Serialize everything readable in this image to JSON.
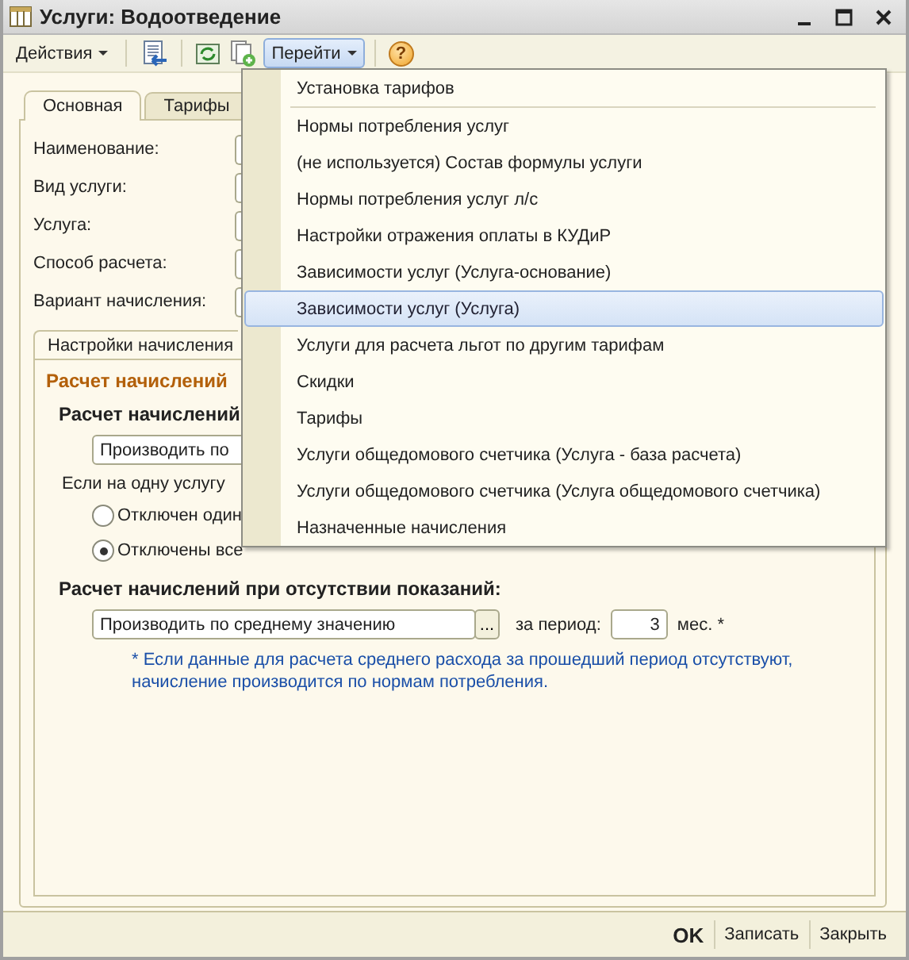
{
  "window": {
    "title": "Услуги: Водоотведение"
  },
  "toolbar": {
    "menus": [
      {
        "label": "Действия",
        "open": false
      },
      {
        "label": "Перейти",
        "open": true
      }
    ],
    "help": "?"
  },
  "tabs": [
    {
      "label": "Основная",
      "selected": true
    },
    {
      "label": "Тарифы",
      "selected": false
    }
  ],
  "fields": [
    {
      "label": "Наименование:"
    },
    {
      "label": "Вид услуги:"
    },
    {
      "label": "Услуга:"
    },
    {
      "label": "Способ расчета:"
    },
    {
      "label": "Вариант начисления:"
    }
  ],
  "group": {
    "tab": "Настройки начисления",
    "heading": "Расчет начислений",
    "subheading": "Расчет начислений",
    "mode_field": {
      "value": "Производить по"
    },
    "condition": "Если на одну услугу",
    "options": [
      {
        "label": "Отключен один",
        "selected": false
      },
      {
        "label": "Отключены все",
        "selected": true
      }
    ],
    "absent_heading": "Расчет начислений при отсутствии показаний:",
    "absent_field": {
      "value": "Производить по среднему значению",
      "button": "..."
    },
    "period_label": "за период:",
    "period_value": "3",
    "period_unit": "мес. *",
    "note": "* Если данные для расчета среднего расхода за прошедший период отсутствуют, начисление производится по нормам потребления."
  },
  "menu": {
    "sections": [
      {
        "items": [
          {
            "label": "Установка тарифов",
            "selected": false
          }
        ]
      },
      {
        "items": [
          {
            "label": "Нормы потребления услуг",
            "selected": false
          },
          {
            "label": "(не используется) Состав формулы услуги",
            "selected": false
          },
          {
            "label": "Нормы потребления услуг л/с",
            "selected": false
          },
          {
            "label": "Настройки отражения оплаты в КУДиР",
            "selected": false
          },
          {
            "label": "Зависимости услуг (Услуга-основание)",
            "selected": false
          },
          {
            "label": "Зависимости услуг (Услуга)",
            "selected": true
          },
          {
            "label": "Услуги для расчета льгот по другим тарифам",
            "selected": false
          },
          {
            "label": "Скидки",
            "selected": false
          },
          {
            "label": "Тарифы",
            "selected": false
          },
          {
            "label": "Услуги общедомового счетчика (Услуга - база расчета)",
            "selected": false
          },
          {
            "label": "Услуги общедомового счетчика (Услуга общедомового счетчика)",
            "selected": false
          },
          {
            "label": "Назначенные начисления",
            "selected": false
          }
        ]
      }
    ]
  },
  "footer": {
    "buttons": [
      {
        "label": "OK",
        "default": true
      },
      {
        "label": "Записать",
        "default": false
      },
      {
        "label": "Закрыть",
        "default": false
      }
    ]
  }
}
